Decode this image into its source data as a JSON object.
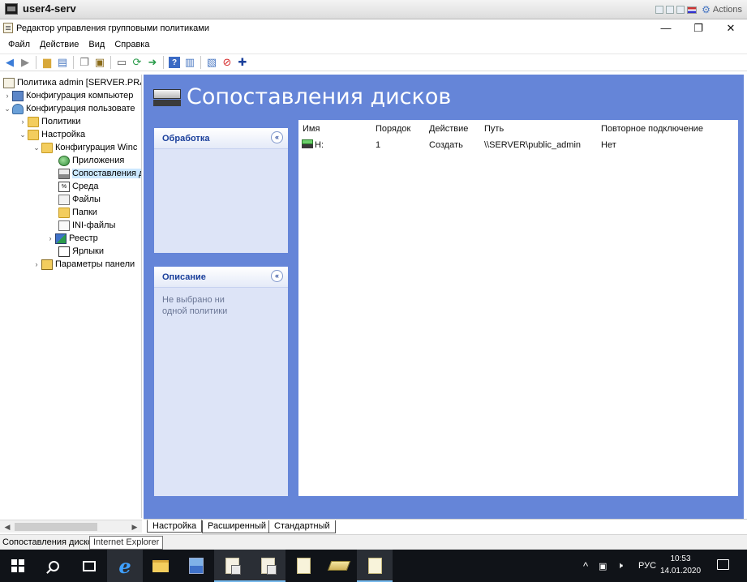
{
  "session": {
    "title": "user4-serv",
    "actions_label": "Actions"
  },
  "window": {
    "title": "Редактор управления групповыми политиками",
    "controls": {
      "minimize": "—",
      "maximize": "❐",
      "close": "✕"
    }
  },
  "menu": [
    "Файл",
    "Действие",
    "Вид",
    "Справка"
  ],
  "tree": {
    "items": [
      {
        "label": "Политика admin [SERVER.PRAH",
        "chevron": "",
        "icon": "policy-icon"
      },
      {
        "label": "Конфигурация компьютер",
        "chevron": "›",
        "icon": "computer-icon"
      },
      {
        "label": "Конфигурация пользовате",
        "chevron": "⌄",
        "icon": "user-icon"
      },
      {
        "label": "Политики",
        "chevron": "›",
        "icon": "folder-icon"
      },
      {
        "label": "Настройка",
        "chevron": "⌄",
        "icon": "folder-icon"
      },
      {
        "label": "Конфигурация Winc",
        "chevron": "⌄",
        "icon": "folder-icon"
      },
      {
        "label": "Приложения",
        "chevron": "",
        "icon": "applications-icon"
      },
      {
        "label": "Сопоставления д",
        "chevron": "",
        "icon": "drive-maps-icon"
      },
      {
        "label": "Среда",
        "chevron": "",
        "icon": "environment-icon"
      },
      {
        "label": "Файлы",
        "chevron": "",
        "icon": "files-icon"
      },
      {
        "label": "Папки",
        "chevron": "",
        "icon": "folders-icon"
      },
      {
        "label": "INI-файлы",
        "chevron": "",
        "icon": "ini-files-icon"
      },
      {
        "label": "Реестр",
        "chevron": "›",
        "icon": "registry-icon"
      },
      {
        "label": "Ярлыки",
        "chevron": "",
        "icon": "shortcuts-icon"
      },
      {
        "label": "Параметры панели",
        "chevron": "›",
        "icon": "control-panel-icon"
      }
    ],
    "selected_index": 7
  },
  "header": {
    "title": "Сопоставления дисков"
  },
  "processing_card": {
    "title": "Обработка",
    "collapse_icon": "«"
  },
  "description_card": {
    "title": "Описание",
    "collapse_icon": "«",
    "text": "Не выбрано ни одной политики"
  },
  "table": {
    "columns": [
      "Имя",
      "Порядок",
      "Действие",
      "Путь",
      "Повторное подключение"
    ],
    "rows": [
      {
        "name": "H:",
        "order": "1",
        "action": "Создать",
        "path": "\\\\SERVER\\public_admin",
        "reconnect": "Нет"
      }
    ]
  },
  "tabs": [
    "Настройка",
    "Расширенный",
    "Стандартный"
  ],
  "status": {
    "text": "Сопоставления диско",
    "tooltip": "Internet Explorer"
  },
  "taskbar": {
    "tray_lang": "РУС",
    "time": "10:53",
    "date": "14.01.2020"
  }
}
